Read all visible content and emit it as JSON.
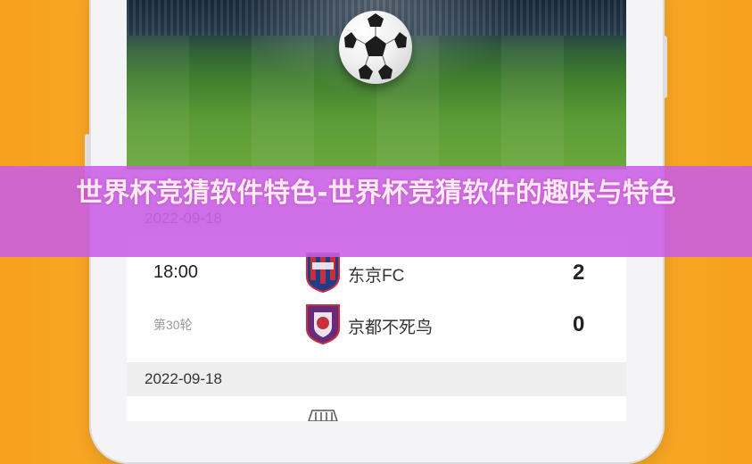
{
  "banner": {
    "title": "世界杯竞猜软件特色-世界杯竞猜软件的趣味与特色"
  },
  "match_list": {
    "groups": [
      {
        "date": "2022-09-18",
        "match": {
          "time": "18:00",
          "round": "第30轮",
          "home": {
            "name": "东京FC",
            "score": "2",
            "badge_icon": "fc-tokyo-badge-icon"
          },
          "away": {
            "name": "京都不死鸟",
            "score": "0",
            "badge_icon": "kyoto-sanga-badge-icon"
          }
        }
      },
      {
        "date": "2022-09-18"
      }
    ]
  },
  "colors": {
    "background": "#f6a11d",
    "banner": "#c95de6",
    "banner_text": "#ffe9f4",
    "date_row": "#eeeeef"
  }
}
